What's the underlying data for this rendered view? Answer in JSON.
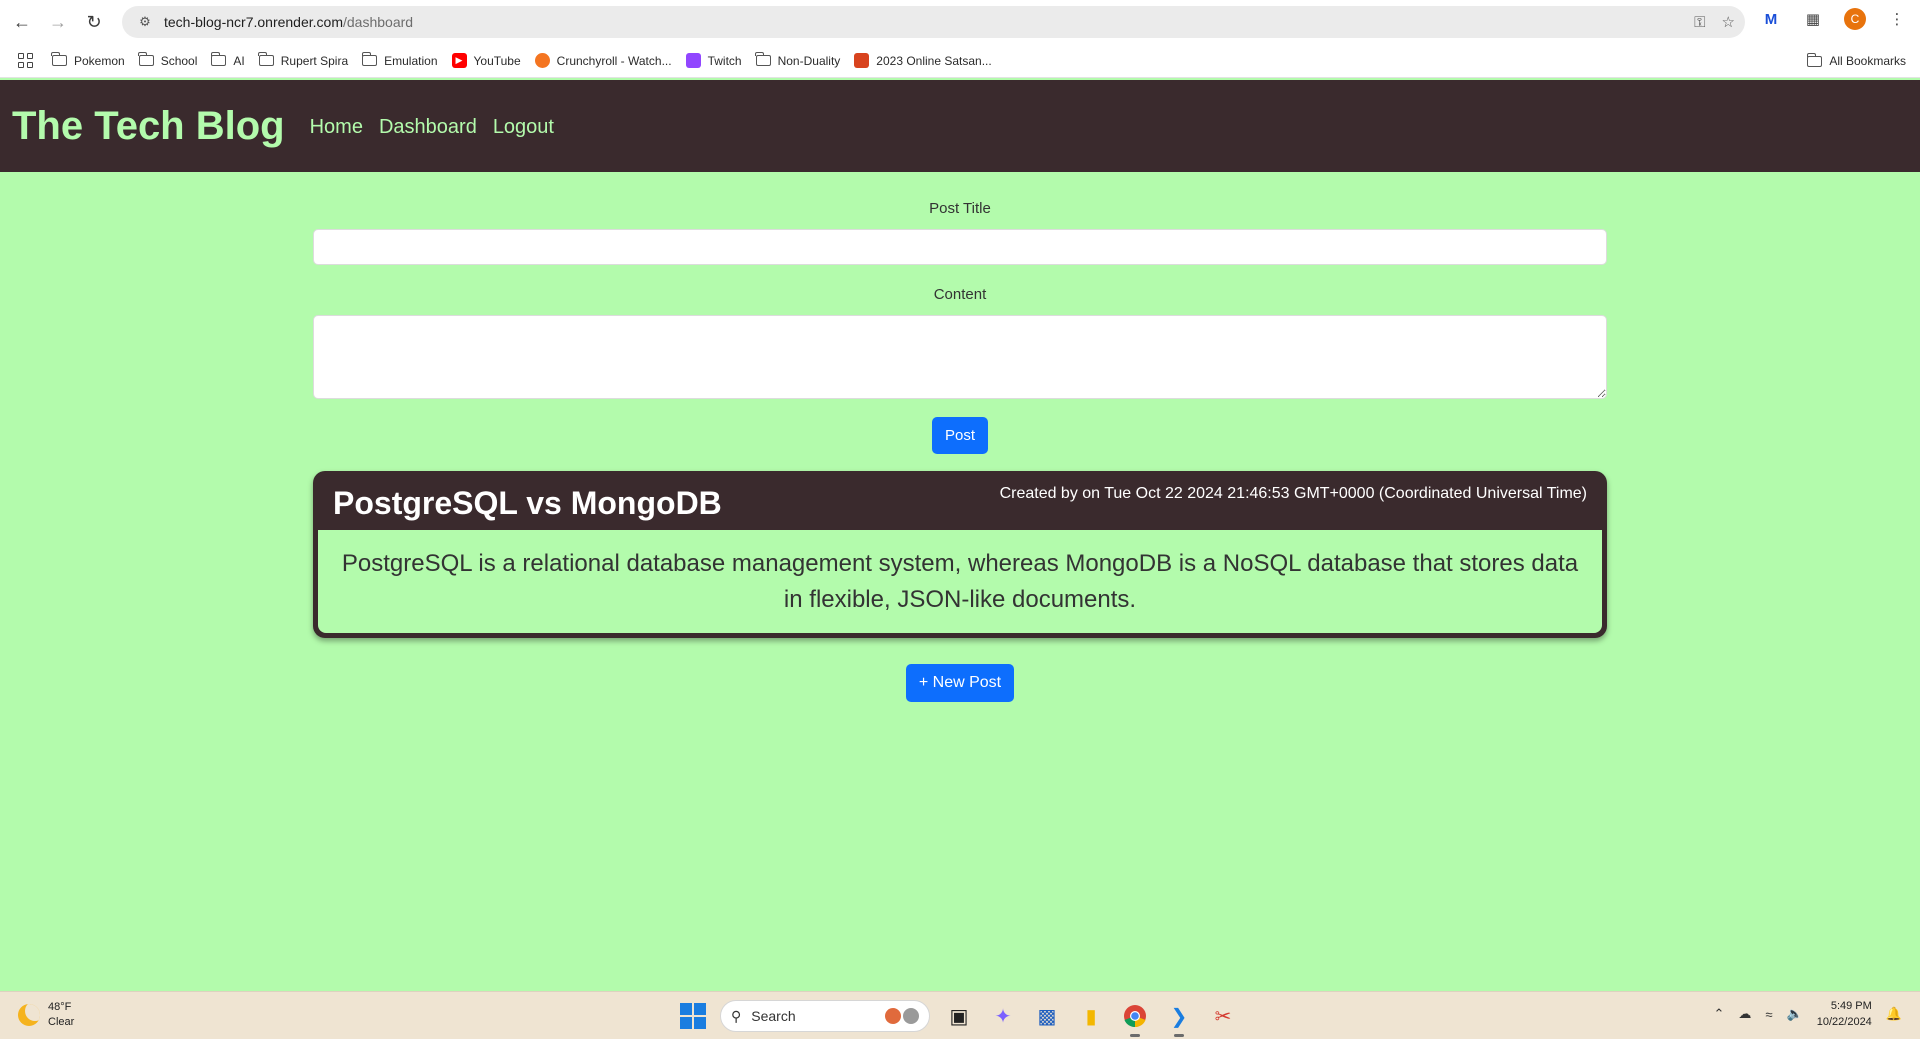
{
  "browser": {
    "url_host": "tech-blog-ncr7.onrender.com",
    "url_path": "/dashboard",
    "profile_initial": "C",
    "bookmarks": [
      {
        "label": "Pokemon",
        "icon": "folder-icon"
      },
      {
        "label": "School",
        "icon": "folder-icon"
      },
      {
        "label": "AI",
        "icon": "folder-icon"
      },
      {
        "label": "Rupert Spira",
        "icon": "folder-icon"
      },
      {
        "label": "Emulation",
        "icon": "folder-icon"
      },
      {
        "label": "YouTube",
        "icon": "youtube-icon"
      },
      {
        "label": "Crunchyroll - Watch...",
        "icon": "crunchyroll-icon"
      },
      {
        "label": "Twitch",
        "icon": "twitch-icon"
      },
      {
        "label": "Non-Duality",
        "icon": "folder-icon"
      },
      {
        "label": "2023 Online Satsan...",
        "icon": "satsang-icon"
      }
    ],
    "all_bookmarks": "All Bookmarks"
  },
  "site": {
    "title": "The Tech Blog",
    "nav": [
      "Home",
      "Dashboard",
      "Logout"
    ]
  },
  "form": {
    "title_label": "Post Title",
    "title_value": "",
    "content_label": "Content",
    "content_value": "",
    "post_button": "Post"
  },
  "posts": [
    {
      "title": "PostgreSQL vs MongoDB",
      "meta": "Created by on Tue Oct 22 2024 21:46:53 GMT+0000 (Coordinated Universal Time)",
      "content": "PostgreSQL is a relational database management system, whereas MongoDB is a NoSQL database that stores data in flexible, JSON-like documents."
    }
  ],
  "new_post_button": "+ New Post",
  "taskbar": {
    "temperature": "48°F",
    "condition": "Clear",
    "search_placeholder": "Search",
    "time": "5:49 PM",
    "date": "10/22/2024"
  },
  "colors": {
    "accent_green": "#b3fbac",
    "header_dark": "#3a2a2d",
    "button_blue": "#0d6efd"
  }
}
